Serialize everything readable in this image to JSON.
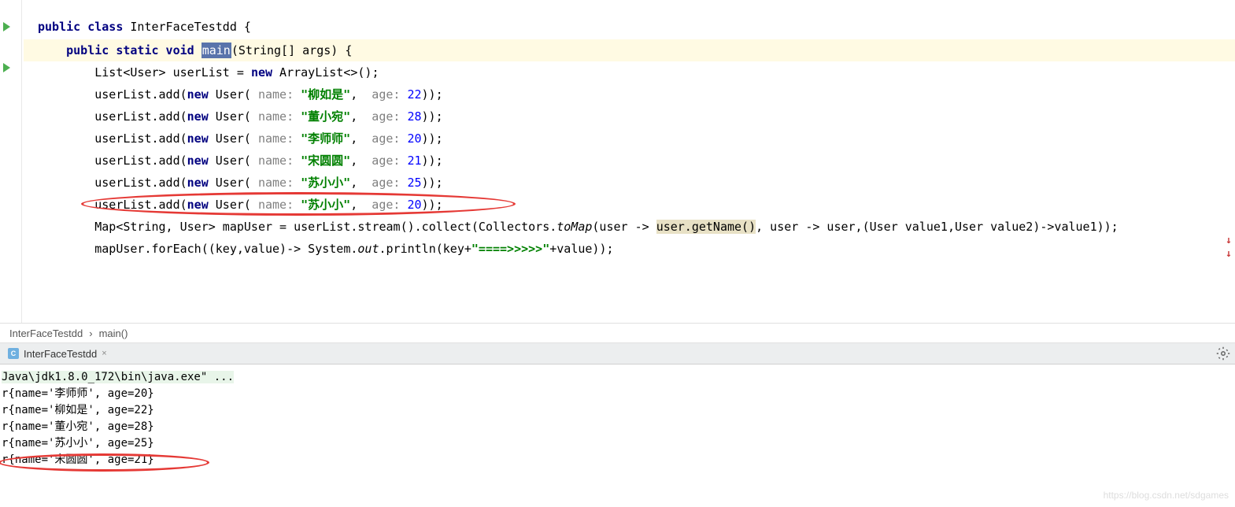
{
  "code": {
    "line1_kw1": "public class",
    "line1_rest": " InterFaceTestdd {",
    "line2_kw": "public static void ",
    "line2_main": "main",
    "line2_rest": "(String[] args) {",
    "line3_a": "List<User> userList = ",
    "line3_kw": "new",
    "line3_b": " ArrayList<>();",
    "addPrefix": "userList.add(",
    "addNew": "new",
    "addUser": " User(",
    "nameHint": " name: ",
    "ageHint": " age: ",
    "user1_name": "\"柳如是\"",
    "user1_age": "22",
    "user2_name": "\"董小宛\"",
    "user2_age": "28",
    "user3_name": "\"李师师\"",
    "user3_age": "20",
    "user4_name": "\"宋圆圆\"",
    "user4_age": "21",
    "user5_name": "\"苏小小\"",
    "user5_age": "25",
    "user6_name": "\"苏小小\"",
    "user6_age": "20",
    "addSuffix": "));",
    "comma": ", ",
    "mapLine_a": "Map<String, User> mapUser = userList.stream().collect(Collectors.",
    "mapLine_toMap": "toMap",
    "mapLine_b": "(user -> ",
    "mapLine_hc": "user.getName()",
    "mapLine_c": ", user -> user,(User value1,User value2)->value1));",
    "forEach_a": "mapUser.forEach((key,value)-> System.",
    "forEach_out": "out",
    "forEach_b": ".println(key+",
    "forEach_str": "\"====>>>>>\"",
    "forEach_c": "+value));"
  },
  "breadcrumb": {
    "class": "InterFaceTestdd",
    "method": "main()",
    "sep": "›"
  },
  "tab": {
    "name": "InterFaceTestdd",
    "close": "×"
  },
  "console": {
    "header": "Java\\jdk1.8.0_172\\bin\\java.exe\" ...",
    "line1": "r{name='李师师', age=20}",
    "line2": "r{name='柳如是', age=22}",
    "line3": "r{name='董小宛', age=28}",
    "line4": "r{name='苏小小', age=25}",
    "line5": "r{name='宋圆圆', age=21}"
  },
  "watermark": "https://blog.csdn.net/sdgames"
}
